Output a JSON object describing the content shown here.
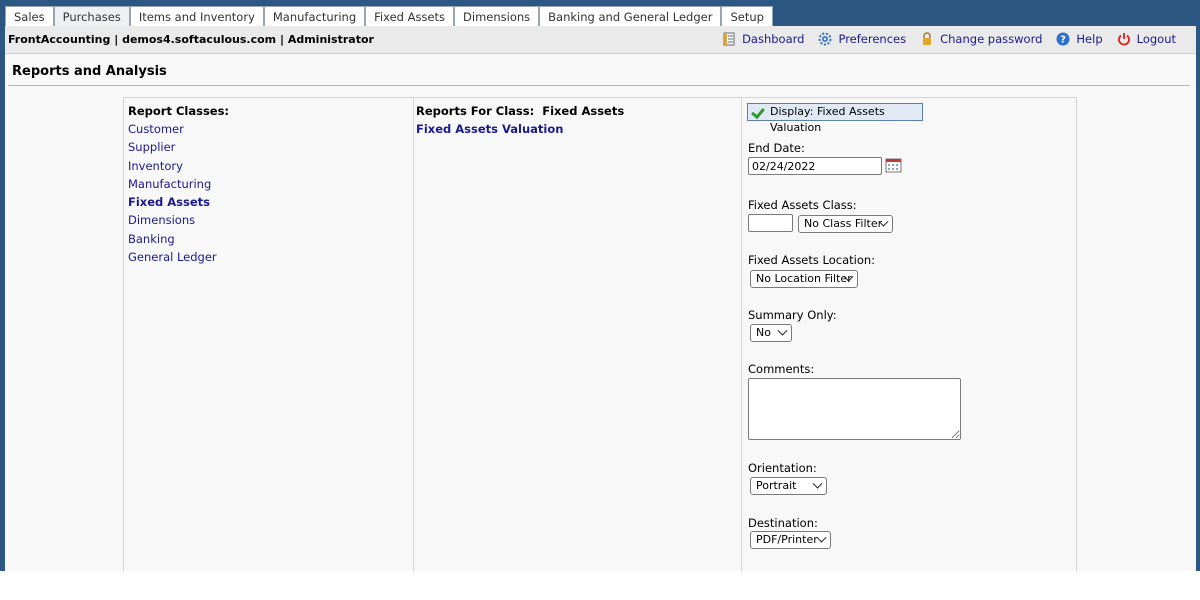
{
  "tabs": [
    {
      "label": "Sales"
    },
    {
      "label": "Purchases"
    },
    {
      "label": "Items and Inventory"
    },
    {
      "label": "Manufacturing"
    },
    {
      "label": "Fixed Assets"
    },
    {
      "label": "Dimensions"
    },
    {
      "label": "Banking and General Ledger"
    },
    {
      "label": "Setup"
    }
  ],
  "header": {
    "company": "FrontAccounting | demos4.softaculous.com | Administrator",
    "links": {
      "dashboard": "Dashboard",
      "preferences": "Preferences",
      "change_password": "Change password",
      "help": "Help",
      "logout": "Logout"
    }
  },
  "page": {
    "title": "Reports and Analysis"
  },
  "classes": {
    "heading": "Report Classes:",
    "items": [
      "Customer",
      "Supplier",
      "Inventory",
      "Manufacturing",
      "Fixed Assets",
      "Dimensions",
      "Banking",
      "General Ledger"
    ],
    "selected": "Fixed Assets"
  },
  "reports": {
    "heading": "Reports For Class:  Fixed Assets",
    "items": [
      "Fixed Assets Valuation"
    ]
  },
  "form": {
    "display_button": "Display: Fixed Assets Valuation",
    "end_date_label": "End Date:",
    "end_date_value": "02/24/2022",
    "class_label": "Fixed Assets Class:",
    "class_filter": "No Class Filter",
    "location_label": "Fixed Assets Location:",
    "location_filter": "No Location Filter",
    "summary_label": "Summary Only:",
    "summary_value": "No",
    "comments_label": "Comments:",
    "orientation_label": "Orientation:",
    "orientation_value": "Portrait",
    "destination_label": "Destination:",
    "destination_value": "PDF/Printer"
  },
  "colors": {
    "band": "#2c5782",
    "link": "#1a1a8c",
    "check": "#2e9a2e"
  }
}
